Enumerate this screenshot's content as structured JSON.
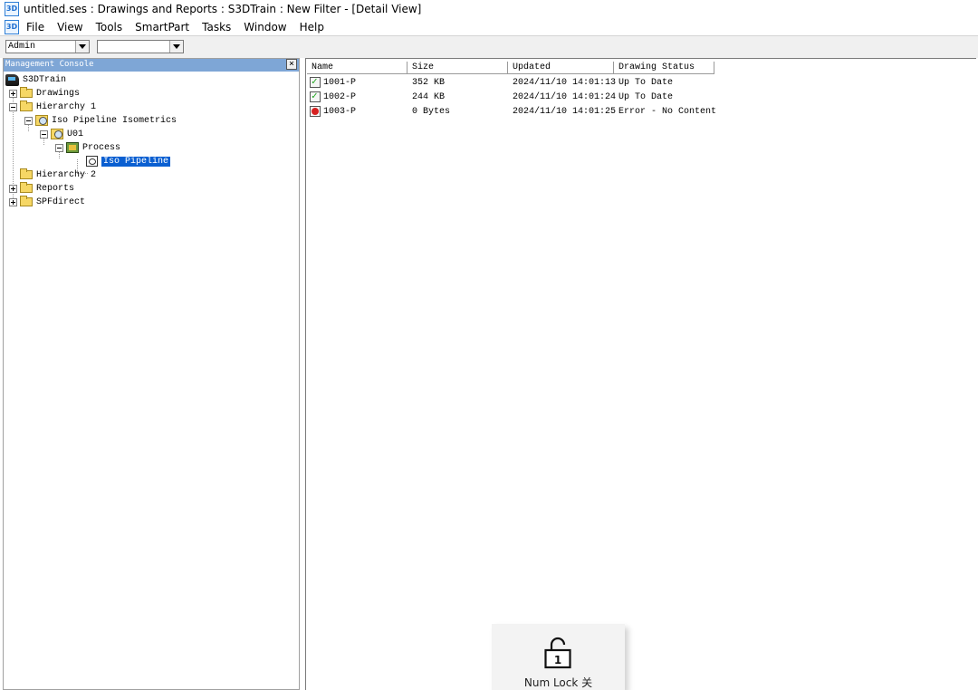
{
  "window": {
    "title": "untitled.ses : Drawings and Reports : S3DTrain : New Filter - [Detail View]",
    "app_icon_label": "3D"
  },
  "menu": [
    "File",
    "View",
    "Tools",
    "SmartPart",
    "Tasks",
    "Window",
    "Help"
  ],
  "toolbar": {
    "combo1_value": "Admin",
    "combo2_value": ""
  },
  "management_console": {
    "title": "Management Console",
    "tree": {
      "root": "S3DTrain",
      "drawings": "Drawings",
      "hierarchy1": "Hierarchy 1",
      "iso_isometrics": "Iso Pipeline Isometrics",
      "u01": "U01",
      "process": "Process",
      "iso_pipeline": "Iso Pipeline",
      "hierarchy2": "Hierarchy 2",
      "reports": "Reports",
      "spfdirect": "SPFdirect"
    }
  },
  "detail_view": {
    "columns": [
      "Name",
      "Size",
      "Updated",
      "Drawing Status"
    ],
    "rows": [
      {
        "name": "1001-P",
        "size": "352 KB",
        "updated": "2024/11/10 14:01:13",
        "status": "Up To Date",
        "icon": "up-to-date-icon"
      },
      {
        "name": "1002-P",
        "size": "244 KB",
        "updated": "2024/11/10 14:01:24",
        "status": "Up To Date",
        "icon": "up-to-date-icon"
      },
      {
        "name": "1003-P",
        "size": "0 Bytes",
        "updated": "2024/11/10 14:01:25",
        "status": "Error - No Content",
        "icon": "error-icon"
      }
    ]
  },
  "numlock_toast": {
    "key_number": "1",
    "label": "Num Lock 关"
  }
}
